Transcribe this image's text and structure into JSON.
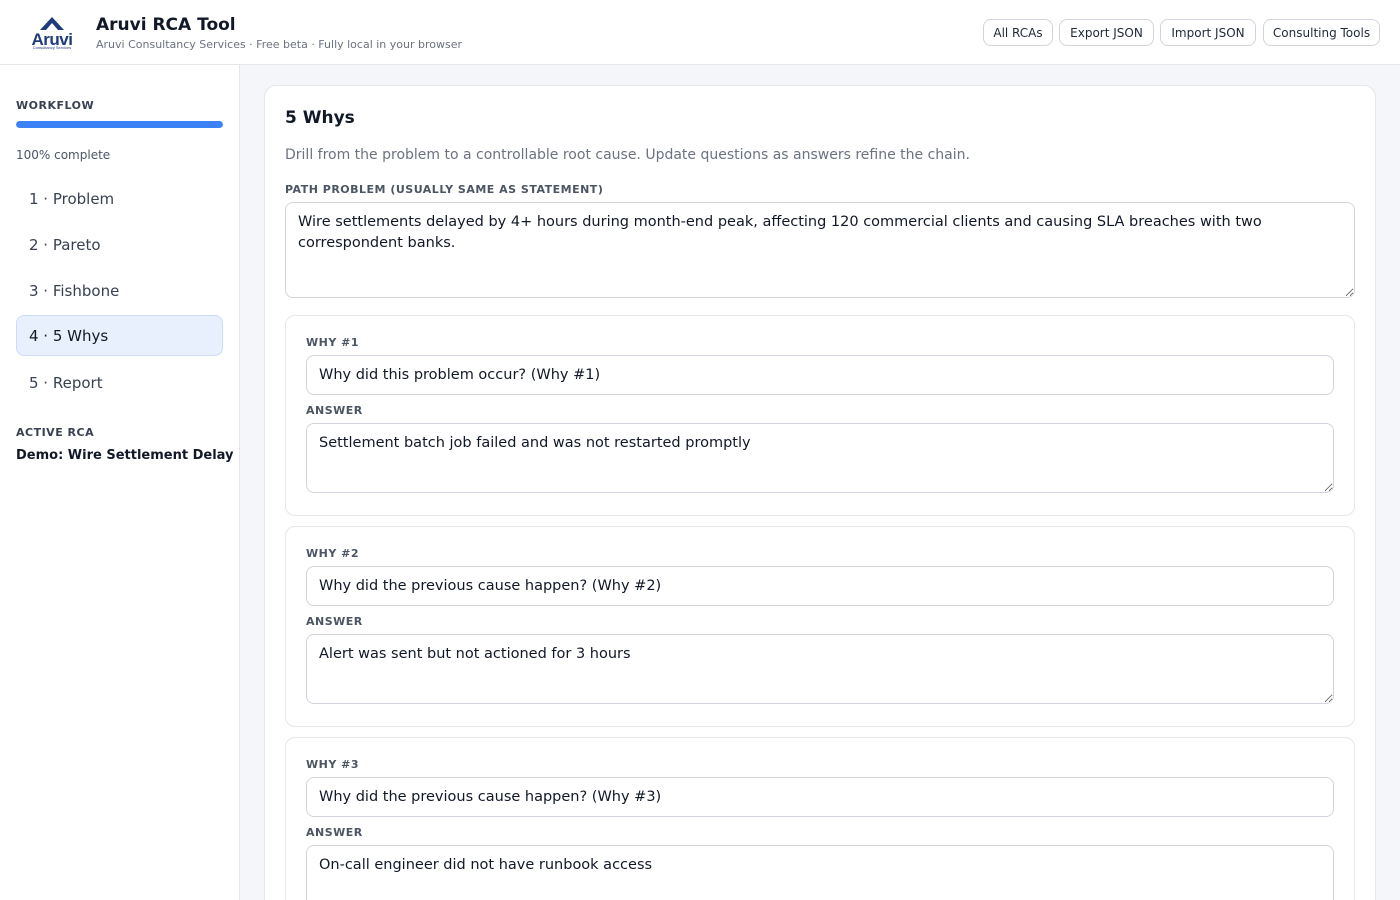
{
  "header": {
    "logo_text": "Aruvi",
    "logo_sub": "Consultancy Services",
    "title": "Aruvi RCA Tool",
    "subtitle": "Aruvi Consultancy Services · Free beta · Fully local in your browser",
    "buttons": {
      "all_rcas": "All RCAs",
      "export_json": "Export JSON",
      "import_json": "Import JSON",
      "consulting_tools": "Consulting Tools"
    }
  },
  "sidebar": {
    "workflow_label": "WORKFLOW",
    "progress_fraction": 1.0,
    "progress_text": "100% complete",
    "items": [
      {
        "label": "1 · Problem"
      },
      {
        "label": "2 · Pareto"
      },
      {
        "label": "3 · Fishbone"
      },
      {
        "label": "4 · 5 Whys",
        "active": true
      },
      {
        "label": "5 · Report"
      }
    ],
    "active_rca_label": "ACTIVE RCA",
    "active_rca_name": "Demo: Wire Settlement Delay"
  },
  "main": {
    "title": "5 Whys",
    "description": "Drill from the problem to a controllable root cause. Update questions as answers refine the chain.",
    "path_problem_label": "PATH PROBLEM (USUALLY SAME AS STATEMENT)",
    "path_problem_value": "Wire settlements delayed by 4+ hours during month-end peak, affecting 120 commercial clients and causing SLA breaches with two correspondent banks.",
    "answer_label": "ANSWER",
    "whys": [
      {
        "label": "WHY #1",
        "question": "Why did this problem occur? (Why #1)",
        "answer": "Settlement batch job failed and was not restarted promptly"
      },
      {
        "label": "WHY #2",
        "question": "Why did the previous cause happen? (Why #2)",
        "answer": "Alert was sent but not actioned for 3 hours"
      },
      {
        "label": "WHY #3",
        "question": "Why did the previous cause happen? (Why #3)",
        "answer": "On-call engineer did not have runbook access"
      }
    ]
  },
  "colors": {
    "accent": "#3b82f6",
    "active_nav_bg": "#e8f0fe",
    "brand": "#1f3c7a"
  }
}
